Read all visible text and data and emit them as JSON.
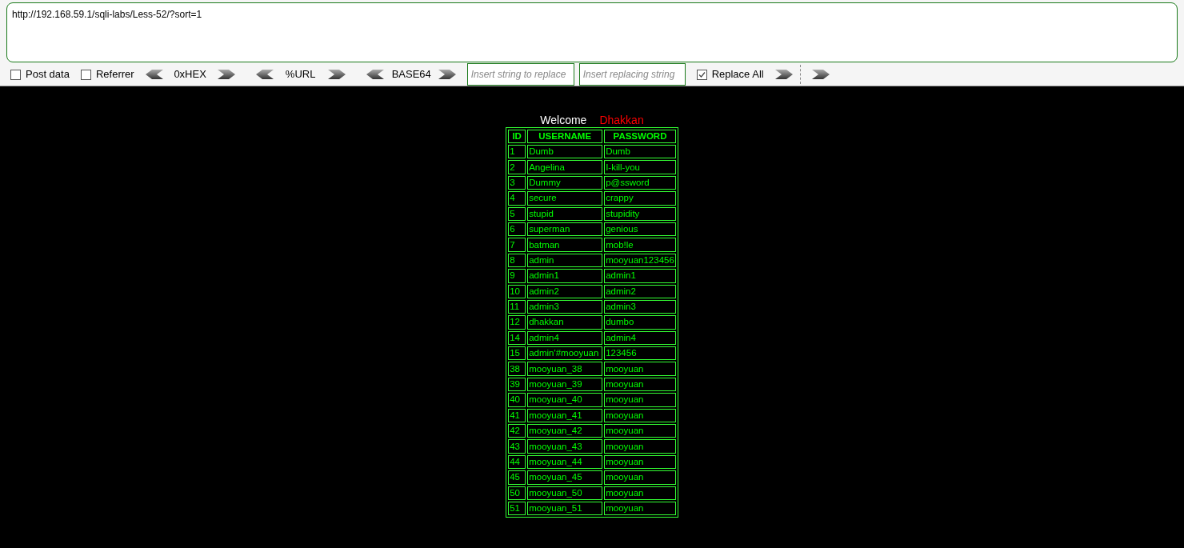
{
  "url_box": {
    "value": "http://192.168.59.1/sqli-labs/Less-52/?sort=1"
  },
  "toolbar": {
    "post_data": {
      "label": "Post data",
      "checked": false
    },
    "referrer": {
      "label": "Referrer",
      "checked": false
    },
    "encoders": [
      "0xHEX",
      "%URL",
      "BASE64"
    ],
    "replace_from": {
      "placeholder": "Insert string to replace"
    },
    "replace_to": {
      "placeholder": "Insert replacing string"
    },
    "replace_all": {
      "label": "Replace All",
      "checked": true
    }
  },
  "welcome": {
    "greeting": "Welcome",
    "name": "Dhakkan"
  },
  "table": {
    "columns": [
      "ID",
      "USERNAME",
      "PASSWORD"
    ],
    "rows": [
      [
        "1",
        "Dumb",
        "Dumb"
      ],
      [
        "2",
        "Angelina",
        "I-kill-you"
      ],
      [
        "3",
        "Dummy",
        "p@ssword"
      ],
      [
        "4",
        "secure",
        "crappy"
      ],
      [
        "5",
        "stupid",
        "stupidity"
      ],
      [
        "6",
        "superman",
        "genious"
      ],
      [
        "7",
        "batman",
        "mob!le"
      ],
      [
        "8",
        "admin",
        "mooyuan123456"
      ],
      [
        "9",
        "admin1",
        "admin1"
      ],
      [
        "10",
        "admin2",
        "admin2"
      ],
      [
        "11",
        "admin3",
        "admin3"
      ],
      [
        "12",
        "dhakkan",
        "dumbo"
      ],
      [
        "14",
        "admin4",
        "admin4"
      ],
      [
        "15",
        "admin'#mooyuan",
        "123456"
      ],
      [
        "38",
        "mooyuan_38",
        "mooyuan"
      ],
      [
        "39",
        "mooyuan_39",
        "mooyuan"
      ],
      [
        "40",
        "mooyuan_40",
        "mooyuan"
      ],
      [
        "41",
        "mooyuan_41",
        "mooyuan"
      ],
      [
        "42",
        "mooyuan_42",
        "mooyuan"
      ],
      [
        "43",
        "mooyuan_43",
        "mooyuan"
      ],
      [
        "44",
        "mooyuan_44",
        "mooyuan"
      ],
      [
        "45",
        "mooyuan_45",
        "mooyuan"
      ],
      [
        "50",
        "mooyuan_50",
        "mooyuan"
      ],
      [
        "51",
        "mooyuan_51",
        "mooyuan"
      ]
    ]
  }
}
